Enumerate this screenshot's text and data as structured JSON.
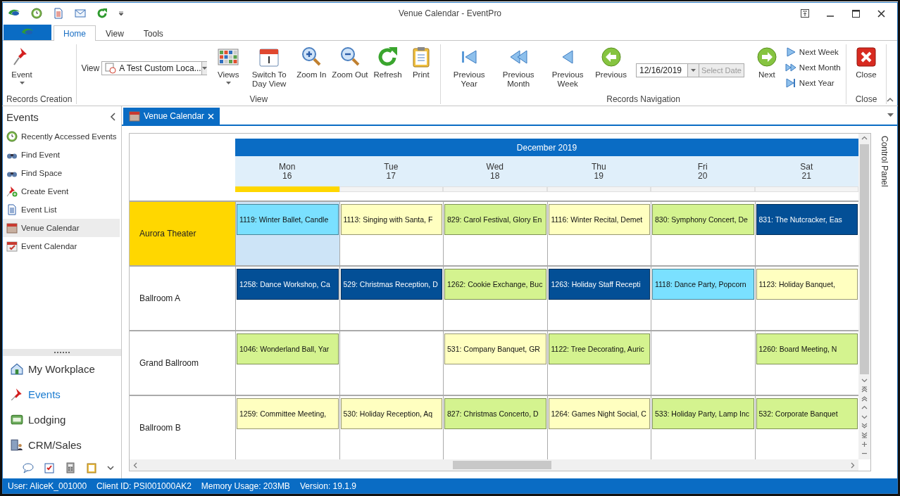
{
  "window": {
    "title": "Venue Calendar - EventPro"
  },
  "ribbon_tabs": [
    {
      "label": "Home",
      "selected": true
    },
    {
      "label": "View",
      "selected": false
    },
    {
      "label": "Tools",
      "selected": false
    }
  ],
  "ribbon_groups": [
    {
      "label": "Records Creation",
      "items": [
        {
          "kind": "large",
          "label": "Event",
          "dropdown": true
        }
      ]
    },
    {
      "label": "View",
      "items": [
        {
          "kind": "combo",
          "label": "View",
          "value": "A Test Custom Loca..."
        },
        {
          "kind": "large",
          "label": "Views",
          "dropdown": true
        },
        {
          "kind": "large",
          "label": "Switch To Day View",
          "dropdown": false
        },
        {
          "kind": "large",
          "label": "Zoom In",
          "dropdown": false
        },
        {
          "kind": "large",
          "label": "Zoom Out",
          "dropdown": false
        },
        {
          "kind": "large",
          "label": "Refresh",
          "dropdown": false
        },
        {
          "kind": "large",
          "label": "Print",
          "dropdown": false
        }
      ]
    },
    {
      "label": "Records Navigation",
      "items": [
        {
          "kind": "large",
          "label": "Previous Year",
          "dropdown": false
        },
        {
          "kind": "large",
          "label": "Previous Month",
          "dropdown": false
        },
        {
          "kind": "large",
          "label": "Previous Week",
          "dropdown": false
        },
        {
          "kind": "large",
          "label": "Previous",
          "dropdown": false
        },
        {
          "kind": "date",
          "value": "12/16/2019",
          "button": "Select Date",
          "disabled": true
        },
        {
          "kind": "large",
          "label": "Next",
          "dropdown": false
        },
        {
          "kind": "stack",
          "labels": [
            "Next Week",
            "Next Month",
            "Next Year"
          ]
        }
      ]
    },
    {
      "label": "Close",
      "items": [
        {
          "kind": "large",
          "label": "Close",
          "dropdown": false
        }
      ]
    }
  ],
  "sidebar": {
    "title": "Events",
    "items": [
      {
        "label": "Recently Accessed Events",
        "selected": false
      },
      {
        "label": "Find Event",
        "selected": false
      },
      {
        "label": "Find Space",
        "selected": false
      },
      {
        "label": "Create Event",
        "selected": false
      },
      {
        "label": "Event List",
        "selected": false
      },
      {
        "label": "Venue Calendar",
        "selected": true
      },
      {
        "label": "Event Calendar",
        "selected": false
      }
    ],
    "modules": [
      {
        "label": "My Workplace",
        "selected": false
      },
      {
        "label": "Events",
        "selected": true
      },
      {
        "label": "Lodging",
        "selected": false
      },
      {
        "label": "CRM/Sales",
        "selected": false
      }
    ]
  },
  "document_tabs": [
    {
      "label": "Venue Calendar",
      "selected": true
    }
  ],
  "calendar": {
    "month": "December 2019",
    "control_panel": "Control Panel",
    "days": [
      {
        "weekday": "Mon",
        "date": "16",
        "selected": true
      },
      {
        "weekday": "Tue",
        "date": "17",
        "selected": false
      },
      {
        "weekday": "Wed",
        "date": "18",
        "selected": false
      },
      {
        "weekday": "Thu",
        "date": "19",
        "selected": false
      },
      {
        "weekday": "Fri",
        "date": "20",
        "selected": false
      },
      {
        "weekday": "Sat",
        "date": "21",
        "selected": false
      }
    ],
    "resources": [
      {
        "name": "Aurora Theater",
        "selected": true,
        "cells": [
          {
            "selected": true,
            "events": [
              {
                "text": "1119: Winter Ballet, Candle",
                "color": "#7ae0ff"
              }
            ]
          },
          {
            "selected": false,
            "events": [
              {
                "text": "1113: Singing with Santa, F",
                "color": "#ffffc0"
              }
            ]
          },
          {
            "selected": false,
            "events": [
              {
                "text": "829: Carol Festival, Glory En",
                "color": "#d4f38f"
              }
            ]
          },
          {
            "selected": false,
            "events": [
              {
                "text": "1116: Winter Recital, Demet",
                "color": "#ffffc0"
              }
            ]
          },
          {
            "selected": false,
            "events": [
              {
                "text": "830: Symphony Concert, De",
                "color": "#d4f38f"
              }
            ]
          },
          {
            "selected": false,
            "events": [
              {
                "text": "831: The Nutcracker, Eas",
                "color": "#034f96"
              }
            ]
          }
        ]
      },
      {
        "name": "Ballroom A",
        "selected": false,
        "cells": [
          {
            "selected": false,
            "events": [
              {
                "text": "1258: Dance Workshop, Ca",
                "color": "#034f96"
              }
            ]
          },
          {
            "selected": false,
            "events": [
              {
                "text": "529: Christmas Reception, D",
                "color": "#034f96"
              }
            ]
          },
          {
            "selected": false,
            "events": [
              {
                "text": "1262: Cookie Exchange, Buc",
                "color": "#d4f38f"
              }
            ]
          },
          {
            "selected": false,
            "events": [
              {
                "text": "1263: Holiday Staff Recepti",
                "color": "#034f96"
              }
            ]
          },
          {
            "selected": false,
            "events": [
              {
                "text": "1118: Dance Party, Popcorn",
                "color": "#7ae0ff"
              }
            ]
          },
          {
            "selected": false,
            "events": [
              {
                "text": "1123: Holiday Banquet,",
                "color": "#ffffc0"
              }
            ]
          }
        ]
      },
      {
        "name": "Grand Ballroom",
        "selected": false,
        "cells": [
          {
            "selected": false,
            "events": [
              {
                "text": "1046: Wonderland Ball, Yar",
                "color": "#d4f38f"
              }
            ]
          },
          {
            "selected": false
          },
          {
            "selected": false,
            "events": [
              {
                "text": "531: Company Banquet, GR",
                "color": "#ffffc0"
              }
            ]
          },
          {
            "selected": false,
            "events": [
              {
                "text": "1122: Tree Decorating, Auric",
                "color": "#d4f38f"
              }
            ]
          },
          {
            "selected": false
          },
          {
            "selected": false,
            "events": [
              {
                "text": "1260: Board Meeting, N",
                "color": "#d4f38f"
              }
            ]
          }
        ]
      },
      {
        "name": "Ballroom B",
        "selected": false,
        "cells": [
          {
            "selected": false,
            "events": [
              {
                "text": "1259: Committee Meeting,",
                "color": "#ffffc0"
              }
            ]
          },
          {
            "selected": false,
            "events": [
              {
                "text": "530: Holiday Reception, Aq",
                "color": "#ffffc0"
              }
            ]
          },
          {
            "selected": false,
            "events": [
              {
                "text": "827: Christmas Concerto, D",
                "color": "#d4f38f"
              }
            ]
          },
          {
            "selected": false,
            "events": [
              {
                "text": "1264: Games Night Social, C",
                "color": "#ffffc0"
              }
            ]
          },
          {
            "selected": false,
            "events": [
              {
                "text": "533: Holiday Party, Lamp Inc",
                "color": "#d4f38f"
              }
            ]
          },
          {
            "selected": false,
            "events": [
              {
                "text": "532: Corporate Banquet",
                "color": "#d4f38f"
              }
            ]
          }
        ]
      }
    ]
  },
  "status_bar": [
    "User: AliceK_001000",
    "Client ID: PSI001000AK2",
    "Memory Usage: 203MB",
    "Version: 19.1.9"
  ]
}
